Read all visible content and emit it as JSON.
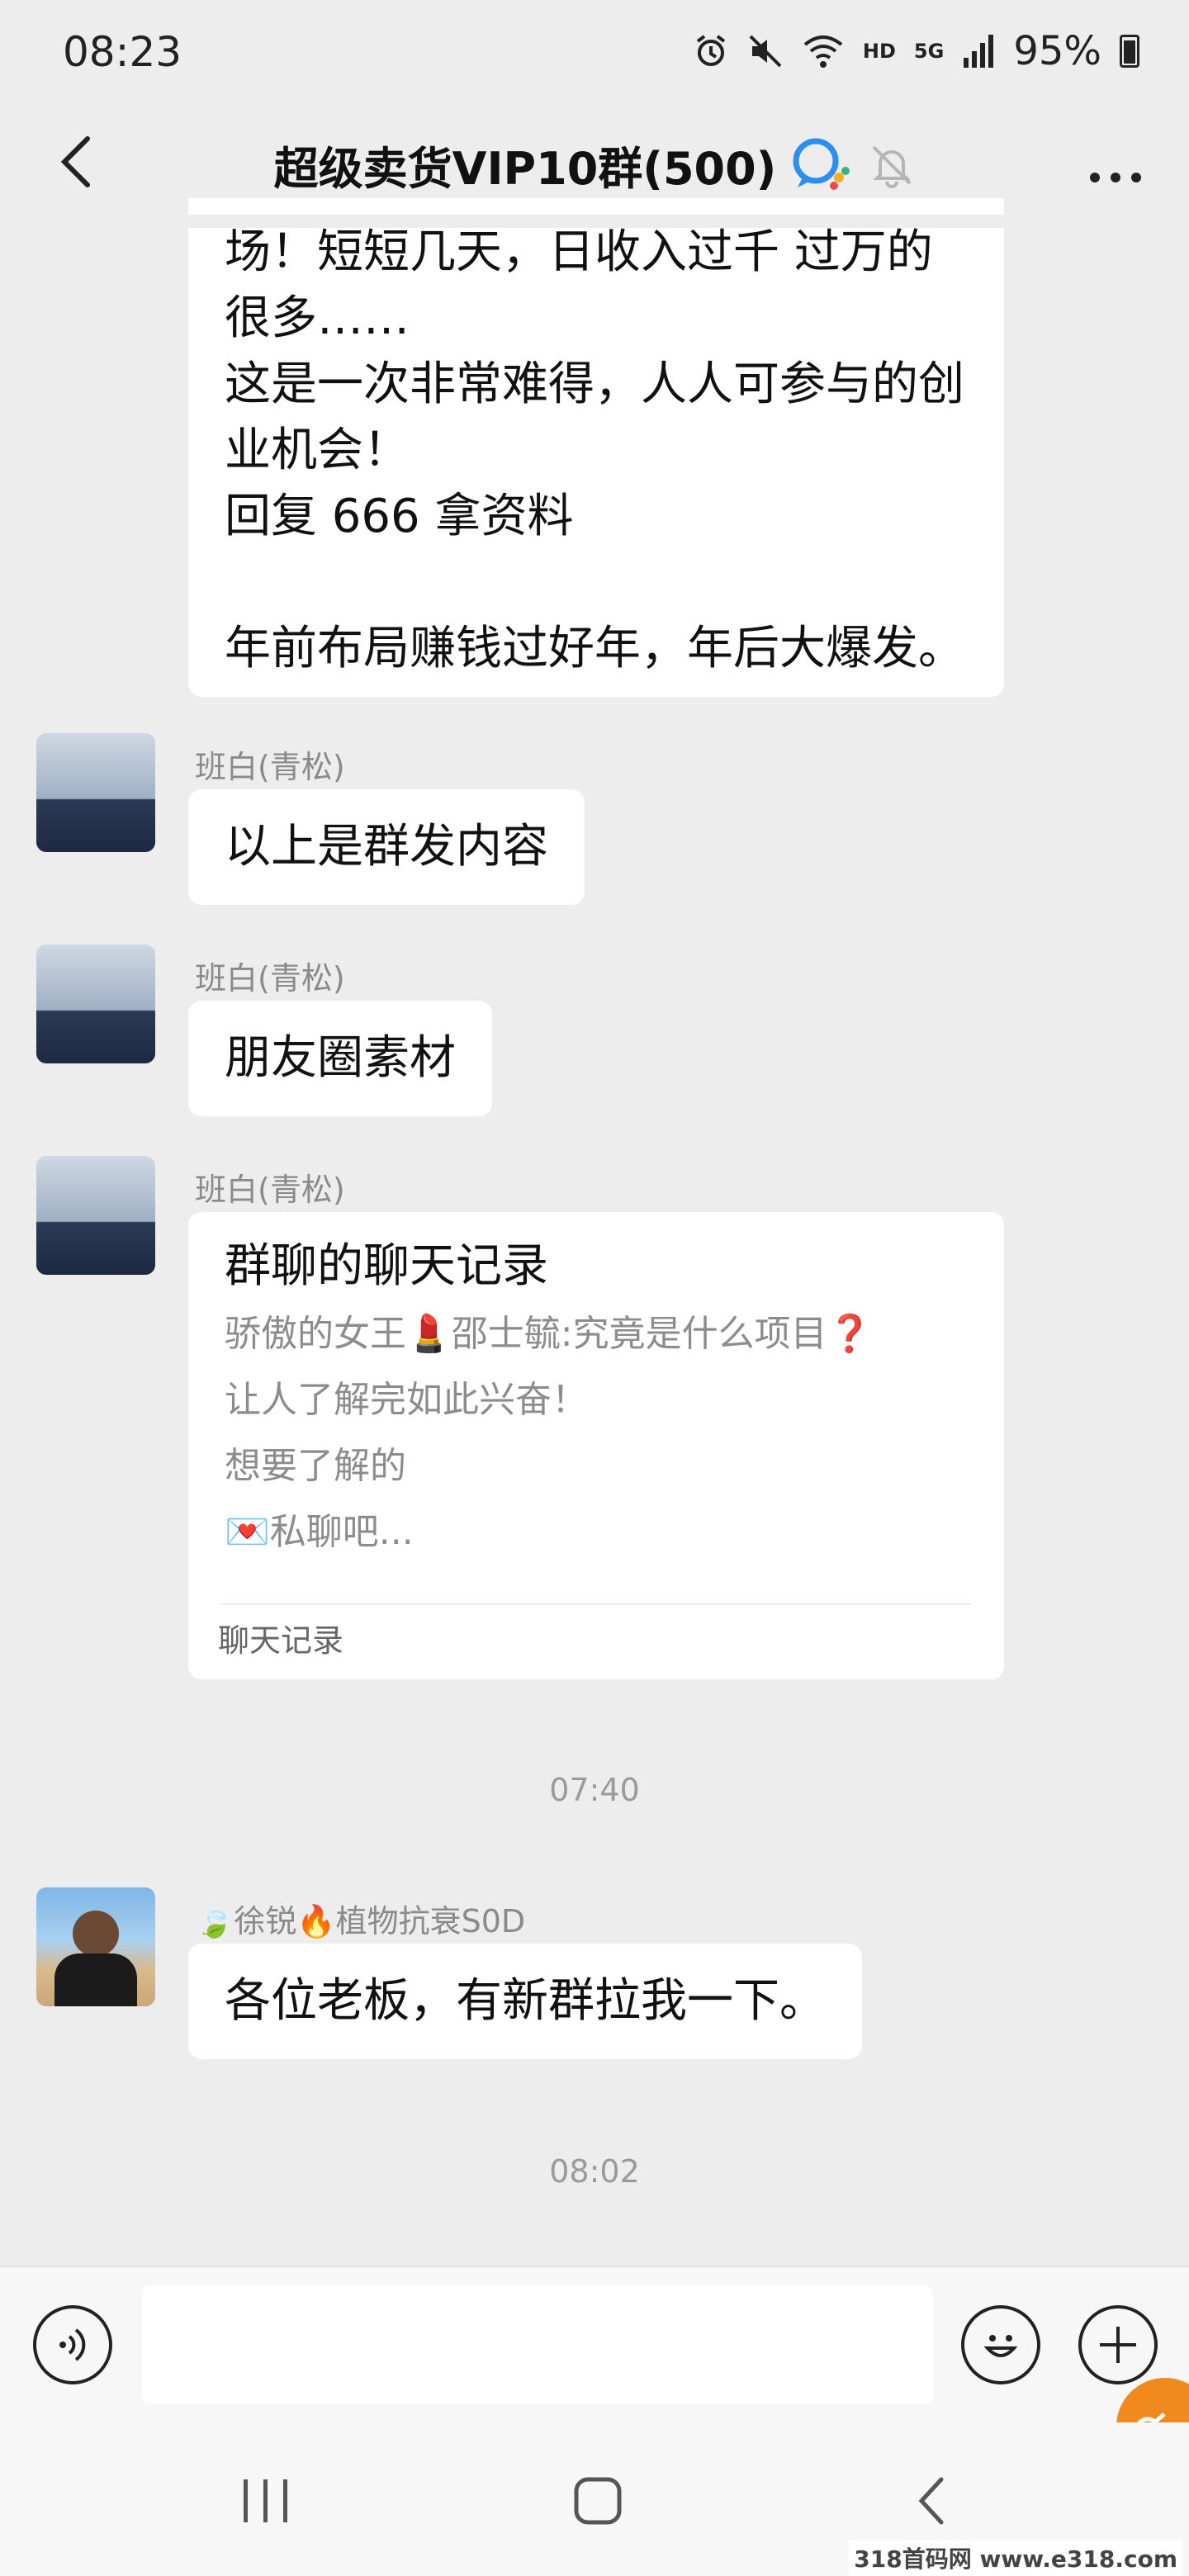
{
  "status_bar": {
    "time": "08:23",
    "hd": "HD",
    "net": "5G",
    "battery": "95%",
    "icons": [
      "alarm-icon",
      "mute-icon",
      "wifi-icon",
      "signal-icon",
      "battery-icon"
    ]
  },
  "header": {
    "title": "超级卖货VIP10群(500)",
    "icons": [
      "back-icon",
      "group-badge-icon",
      "bell-off-icon",
      "more-icon"
    ]
  },
  "messages": {
    "m0": {
      "lines": [
        "场！短短几天，日收入过千 过万的",
        "很多……",
        "这是一次非常难得，人人可参与的创",
        "业机会！",
        "回复 666 拿资料",
        "",
        "年前布局赚钱过好年，年后大爆发。"
      ]
    },
    "m1": {
      "sender": "班白(青松)",
      "text": "以上是群发内容"
    },
    "m2": {
      "sender": "班白(青松)",
      "text": "朋友圈素材"
    },
    "m3": {
      "sender": "班白(青松)",
      "title": "群聊的聊天记录",
      "lines": [
        "骄傲的女王💄邵士毓:究竟是什么项目❓",
        "让人了解完如此兴奋！",
        "想要了解的",
        "💌私聊吧..."
      ],
      "footer": "聊天记录"
    },
    "time1": "07:40",
    "m4": {
      "sender": "🍃徐锐🔥植物抗衰S0D",
      "text": "各位老板，有新群拉我一下。"
    },
    "time2": "08:02"
  },
  "input": {
    "placeholder": ""
  },
  "watermark": "318首码网 www.e318.com"
}
